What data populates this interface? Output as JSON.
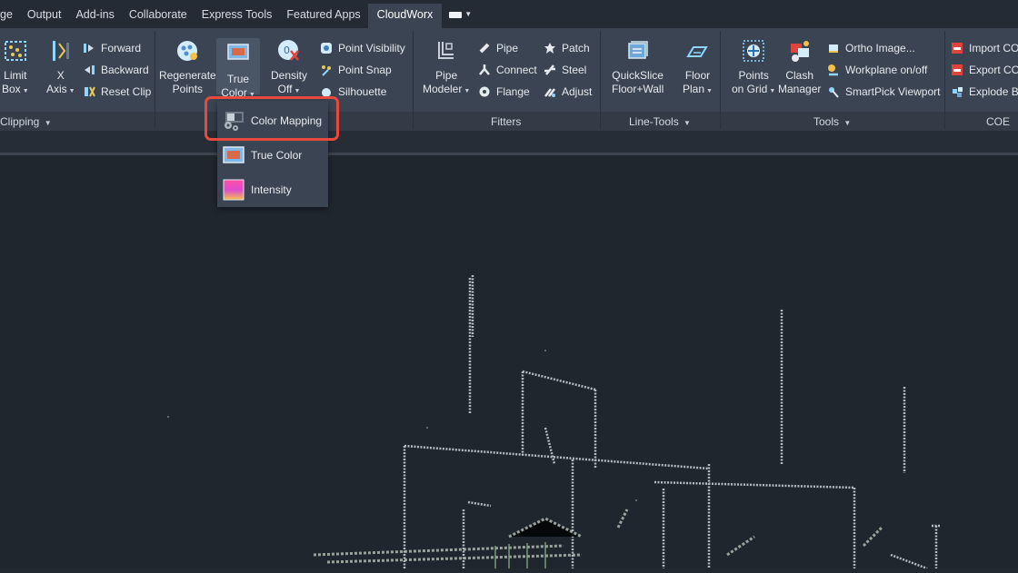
{
  "menu_tabs": [
    "ge",
    "Output",
    "Add-ins",
    "Collaborate",
    "Express Tools",
    "Featured Apps",
    "CloudWorx"
  ],
  "active_tab": "CloudWorx",
  "ribbon": {
    "clipping": {
      "panel_label": "Clipping",
      "limit_box": [
        "Limit",
        "Box"
      ],
      "x_axis": [
        "X",
        "Axis"
      ],
      "forward": "Forward",
      "backward": "Backward",
      "reset_clip": "Reset Clip"
    },
    "points": {
      "regenerate": [
        "Regenerate",
        "Points"
      ],
      "true_color": [
        "True",
        "Color"
      ],
      "density": [
        "Density",
        "Off"
      ],
      "point_visibility": "Point Visibility",
      "point_snap": "Point Snap",
      "silhouette": "Silhouette"
    },
    "fitters": {
      "panel_label": "Fitters",
      "pipe_modeler": [
        "Pipe",
        "Modeler"
      ],
      "pipe": "Pipe",
      "connect": "Connect",
      "flange": "Flange",
      "patch": "Patch",
      "steel": "Steel",
      "adjust": "Adjust"
    },
    "line_tools": {
      "panel_label": "Line-Tools",
      "quickslice": [
        "QuickSlice",
        "Floor+Wall"
      ],
      "floor_plan": [
        "Floor",
        "Plan"
      ]
    },
    "tools": {
      "panel_label": "Tools",
      "points_on_grid": [
        "Points",
        "on Grid"
      ],
      "clash_manager": [
        "Clash",
        "Manager"
      ],
      "ortho_image": "Ortho Image...",
      "workplane": "Workplane on/off",
      "smartpick": "SmartPick Viewport"
    },
    "coe": {
      "panel_label": "COE",
      "import": "Import CO",
      "export": "Export CO",
      "explode": "Explode B"
    }
  },
  "dropdown": {
    "items": [
      "Color Mapping",
      "True Color",
      "Intensity"
    ],
    "highlighted": "Color Mapping"
  },
  "colors": {
    "highlight_border": "#e9493d",
    "ribbon_bg": "#3b4452",
    "viewport_bg": "#1f262e"
  }
}
